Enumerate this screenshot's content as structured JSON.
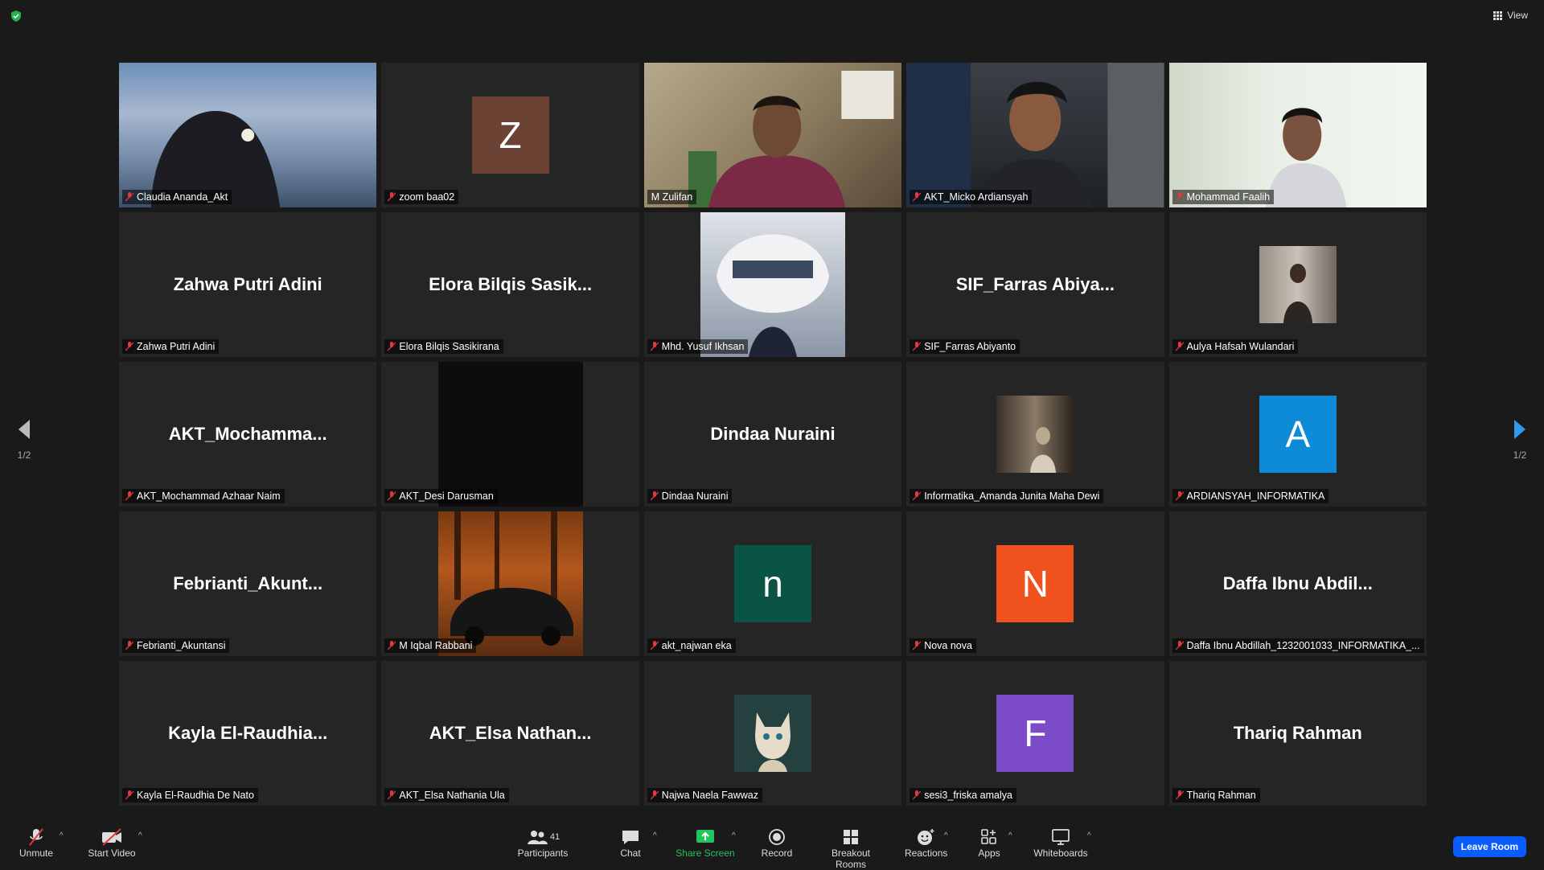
{
  "top": {
    "view_label": "View"
  },
  "nav": {
    "left_page": "1/2",
    "right_page": "1/2"
  },
  "tiles": [
    {
      "name": "Claudia Ananda_Akt"
    },
    {
      "name": "zoom baa02",
      "letter": "Z"
    },
    {
      "name": "M Zulifan"
    },
    {
      "name": "AKT_Micko Ardiansyah"
    },
    {
      "name": "Mohammad Faalih"
    },
    {
      "name": "Zahwa Putri Adini",
      "display": "Zahwa Putri Adini"
    },
    {
      "name": "Elora Bilqis Sasikirana",
      "display": "Elora  Bilqis  Sasik..."
    },
    {
      "name": "Mhd. Yusuf Ikhsan"
    },
    {
      "name": "SIF_Farras Abiyanto",
      "display": "SIF_Farras  Abiya..."
    },
    {
      "name": "Aulya Hafsah Wulandari"
    },
    {
      "name": "AKT_Mochammad Azhaar Naim",
      "display": "AKT_Mochamma..."
    },
    {
      "name": "AKT_Desi Darusman"
    },
    {
      "name": "Dindaa Nuraini",
      "display": "Dindaa Nuraini"
    },
    {
      "name": "Informatika_Amanda Junita Maha Dewi"
    },
    {
      "name": "ARDIANSYAH_INFORMATIKA",
      "letter": "A"
    },
    {
      "name": "Febrianti_Akuntansi",
      "display": "Febrianti_Akunt..."
    },
    {
      "name": "M Iqbal Rabbani"
    },
    {
      "name": "akt_najwan eka",
      "letter": "n"
    },
    {
      "name": "Nova nova",
      "letter": "N"
    },
    {
      "name": "Daffa Ibnu Abdillah_1232001033_INFORMATIKA_...",
      "display": "Daffa  Ibnu  Abdil..."
    },
    {
      "name": "Kayla El-Raudhia De Nato",
      "display": "Kayla  El-Raudhia..."
    },
    {
      "name": "AKT_Elsa Nathania Ula",
      "display": "AKT_Elsa  Nathan..."
    },
    {
      "name": "Najwa Naela Fawwaz"
    },
    {
      "name": "sesi3_friska amalya",
      "letter": "F"
    },
    {
      "name": "Thariq Rahman",
      "display": "Thariq Rahman"
    }
  ],
  "colors": {
    "active_speaker": "#c7e56b",
    "avatar_brown": "#6b4233",
    "avatar_blue": "#0e8bd6",
    "avatar_teal": "#0a5446",
    "avatar_orange": "#f0521e",
    "avatar_purple": "#7b4bc8",
    "leave": "#0b5cff"
  },
  "toolbar": {
    "unmute": "Unmute",
    "start_video": "Start Video",
    "participants": "Participants",
    "participants_count": "41",
    "chat": "Chat",
    "share_screen": "Share Screen",
    "record": "Record",
    "breakout_rooms": "Breakout Rooms",
    "reactions": "Reactions",
    "apps": "Apps",
    "whiteboards": "Whiteboards",
    "leave_room": "Leave Room"
  }
}
